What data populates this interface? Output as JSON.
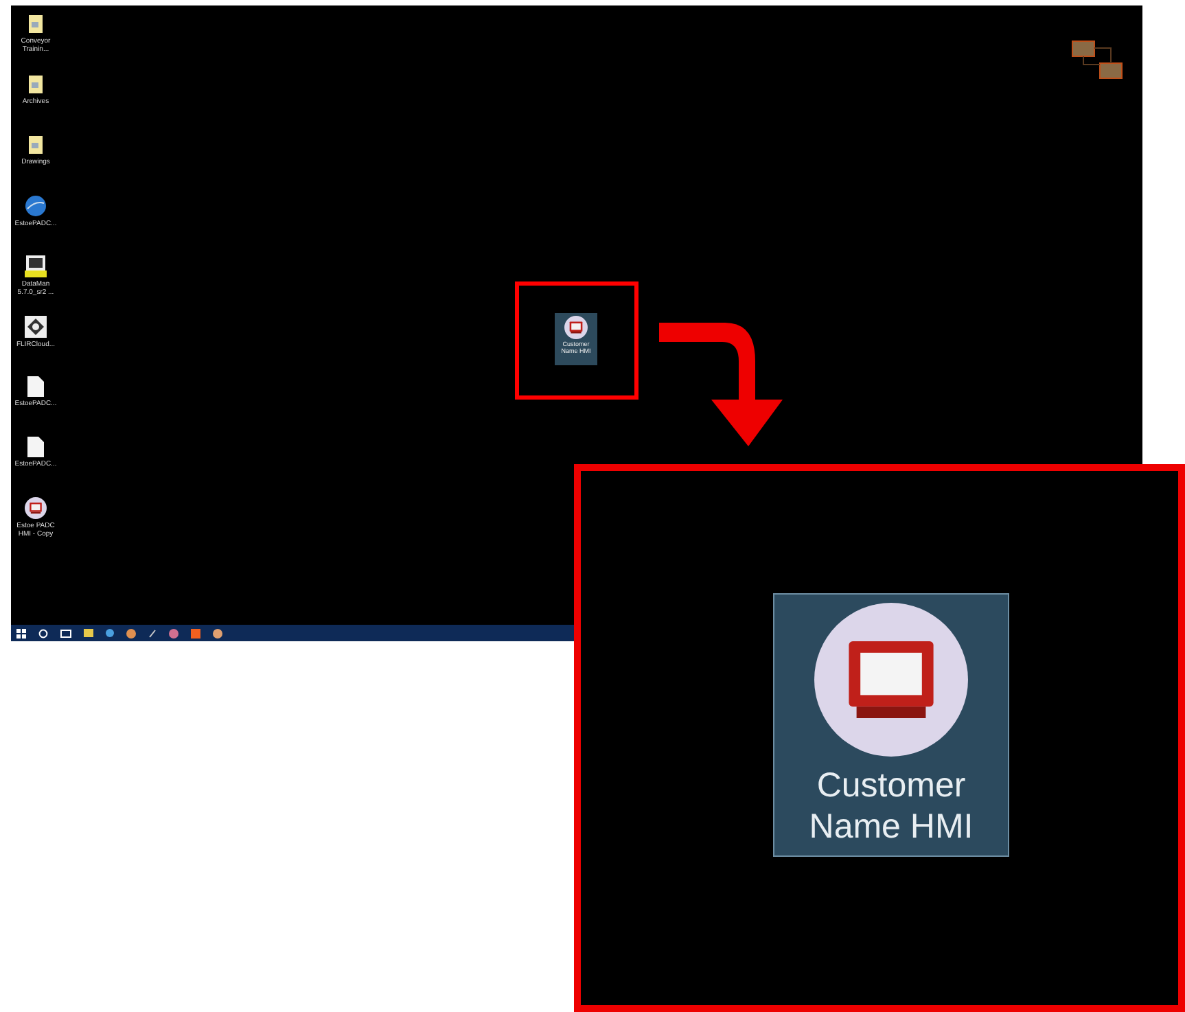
{
  "desktop": {
    "icons": [
      {
        "kind": "folder",
        "label": "Conveyor Trainin..."
      },
      {
        "kind": "folder",
        "label": "Archives"
      },
      {
        "kind": "folder",
        "label": "Drawings"
      },
      {
        "kind": "globe",
        "label": "EstoePADC..."
      },
      {
        "kind": "app",
        "label": "DataMan 5.7.0_sr2 ..."
      },
      {
        "kind": "flir",
        "label": "FLIRCloud..."
      },
      {
        "kind": "file",
        "label": "EstoePADC..."
      },
      {
        "kind": "file",
        "label": "EstoePADC..."
      },
      {
        "kind": "hmi",
        "label": "Estoe PADC HMI - Copy"
      }
    ],
    "highlighted_icon": {
      "label": "Customer Name HMI"
    }
  },
  "callout": {
    "label": "Customer Name HMI"
  }
}
